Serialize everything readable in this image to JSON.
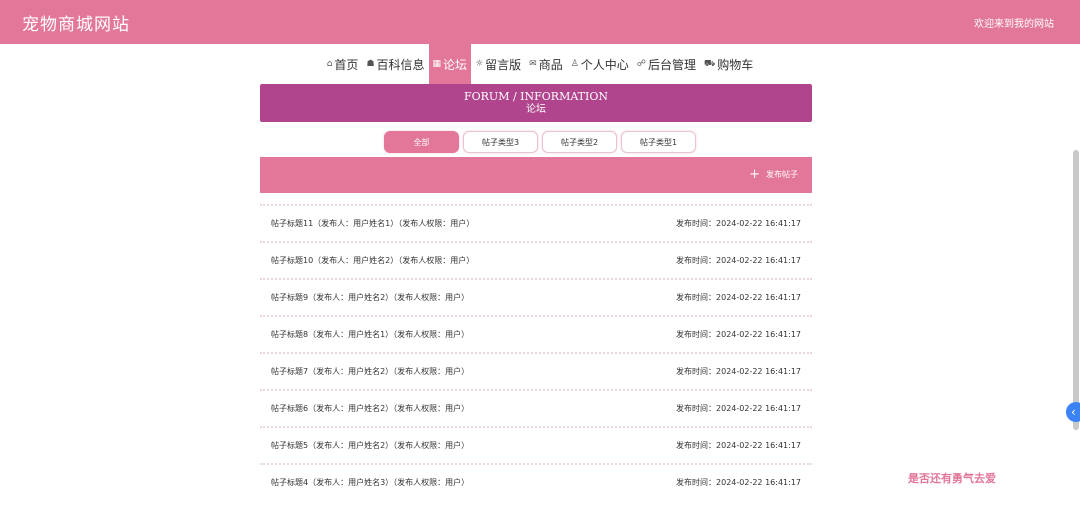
{
  "header": {
    "site_title": "宠物商城网站",
    "welcome": "欢迎来到我的网站"
  },
  "nav": [
    {
      "icon": "⌂",
      "icon_name": "home-icon",
      "label": "首页",
      "active": false
    },
    {
      "icon": "☗",
      "icon_name": "book-icon",
      "label": "百科信息",
      "active": false
    },
    {
      "icon": "▦",
      "icon_name": "forum-icon",
      "label": "论坛",
      "active": true
    },
    {
      "icon": "☼",
      "icon_name": "message-icon",
      "label": "留言版",
      "active": false
    },
    {
      "icon": "✉",
      "icon_name": "goods-icon",
      "label": "商品",
      "active": false
    },
    {
      "icon": "♙",
      "icon_name": "user-icon",
      "label": "个人中心",
      "active": false
    },
    {
      "icon": "☍",
      "icon_name": "link-icon",
      "label": "后台管理",
      "active": false
    },
    {
      "icon": "⛟",
      "icon_name": "cart-icon",
      "label": "购物车",
      "active": false
    }
  ],
  "banner": {
    "title_en": "FORUM / INFORMATION",
    "title_cn": "论坛"
  },
  "tabs": [
    {
      "label": "全部",
      "active": true
    },
    {
      "label": "帖子类型3",
      "active": false
    },
    {
      "label": "帖子类型2",
      "active": false
    },
    {
      "label": "帖子类型1",
      "active": false
    }
  ],
  "actions": {
    "publish_icon": "+",
    "publish_label": "发布帖子"
  },
  "posts": [
    {
      "title": "帖子标题11（发布人：用户姓名1）（发布人权限：用户）",
      "time": "发布时间：2024-02-22 16:41:17"
    },
    {
      "title": "帖子标题10（发布人：用户姓名2）（发布人权限：用户）",
      "time": "发布时间：2024-02-22 16:41:17"
    },
    {
      "title": "帖子标题9（发布人：用户姓名2）（发布人权限：用户）",
      "time": "发布时间：2024-02-22 16:41:17"
    },
    {
      "title": "帖子标题8（发布人：用户姓名1）（发布人权限：用户）",
      "time": "发布时间：2024-02-22 16:41:17"
    },
    {
      "title": "帖子标题7（发布人：用户姓名2）（发布人权限：用户）",
      "time": "发布时间：2024-02-22 16:41:17"
    },
    {
      "title": "帖子标题6（发布人：用户姓名2）（发布人权限：用户）",
      "time": "发布时间：2024-02-22 16:41:17"
    },
    {
      "title": "帖子标题5（发布人：用户姓名2）（发布人权限：用户）",
      "time": "发布时间：2024-02-22 16:41:17"
    },
    {
      "title": "帖子标题4（发布人：用户姓名3）（发布人权限：用户）",
      "time": "发布时间：2024-02-22 16:41:17"
    }
  ],
  "watermark": "是否还有勇气去爱",
  "side_toggle_icon": "‹",
  "colors": {
    "primary": "#e37799",
    "banner": "#b0458d",
    "toggle": "#3b82f6"
  }
}
